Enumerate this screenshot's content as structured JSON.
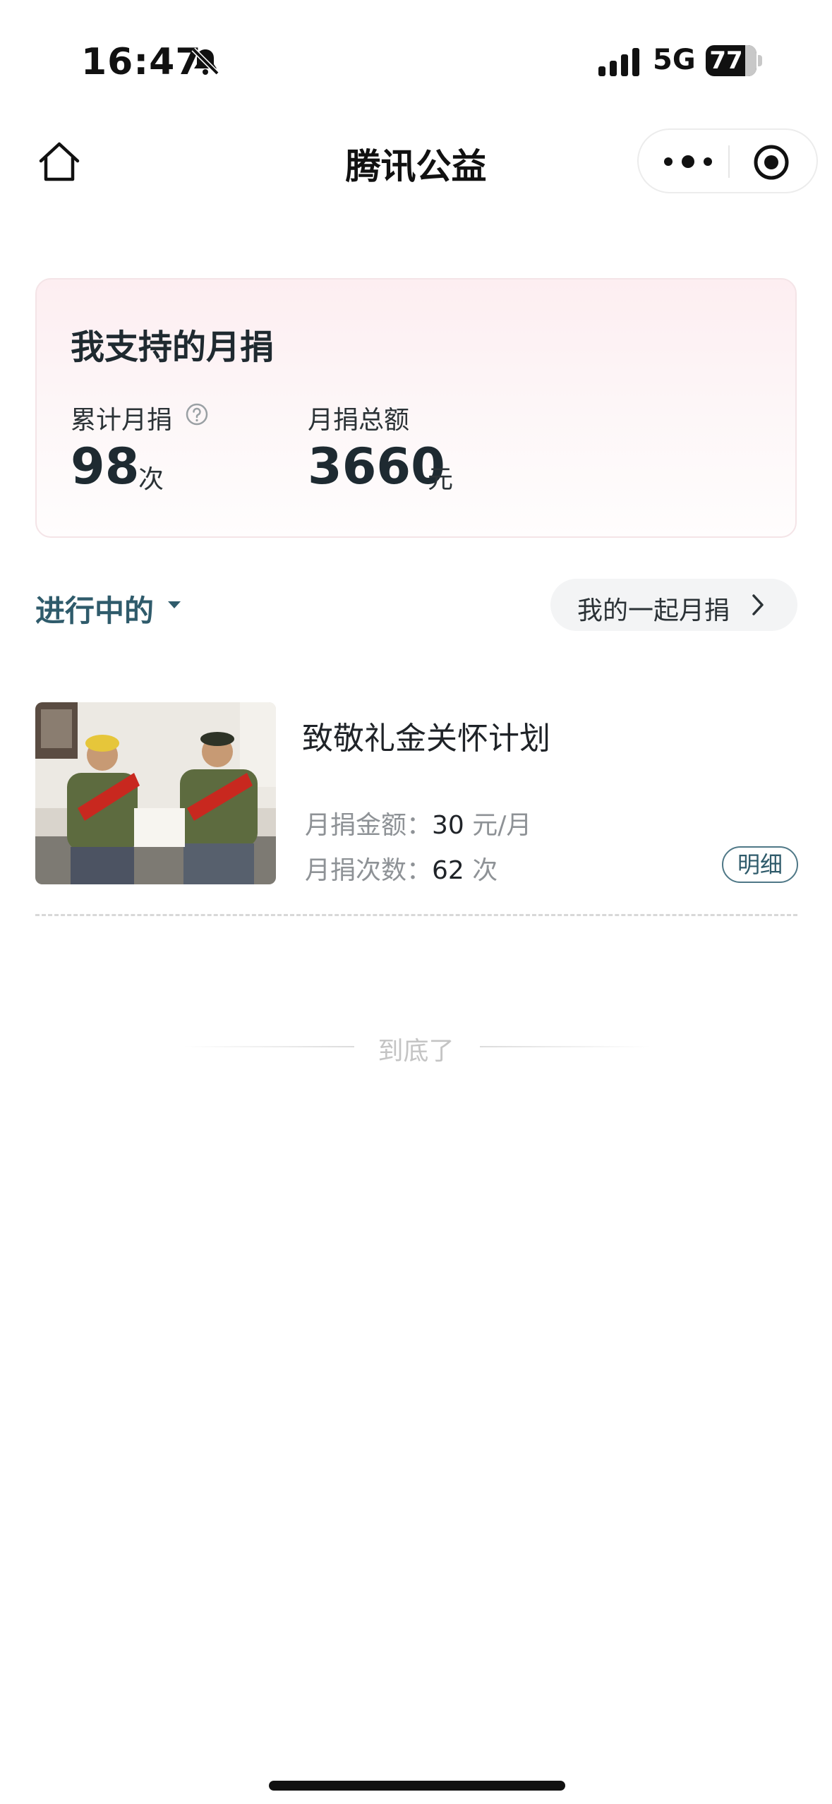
{
  "status_bar": {
    "time": "16:47",
    "network": "5G",
    "battery": "77"
  },
  "nav": {
    "title": "腾讯公益"
  },
  "summary": {
    "title": "我支持的月捐",
    "cumulative_label": "累计月捐",
    "cumulative_value": "98",
    "cumulative_unit": "次",
    "total_label": "月捐总额",
    "total_value": "3660",
    "total_unit": "元"
  },
  "filter": {
    "label": "进行中的",
    "together_button": "我的一起月捐"
  },
  "items": [
    {
      "title": "致敬礼金关怀计划",
      "amount_label": "月捐金额：",
      "amount_value": "30",
      "amount_unit": "元/月",
      "count_label": "月捐次数：",
      "count_value": "62",
      "count_unit": "次",
      "detail_button": "明细"
    }
  ],
  "end_text": "到底了"
}
